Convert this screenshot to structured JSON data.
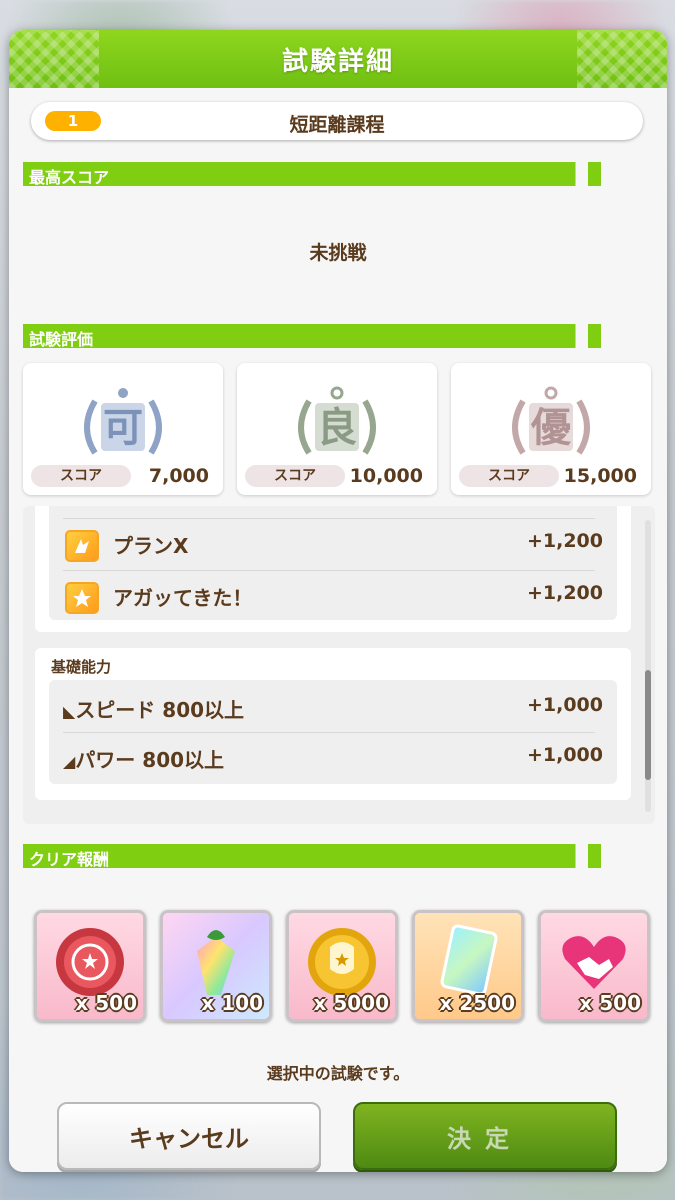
{
  "header": {
    "title": "試験詳細"
  },
  "exam": {
    "number": "1",
    "name": "短距離課程"
  },
  "best_score": {
    "section_title": "最高スコア",
    "value": "未挑戦"
  },
  "evaluation": {
    "section_title": "試験評価",
    "grades": [
      {
        "grade": "可",
        "score_label": "スコア",
        "score": "7,000"
      },
      {
        "grade": "良",
        "score_label": "スコア",
        "score": "10,000"
      },
      {
        "grade": "優",
        "score_label": "スコア",
        "score": "15,000"
      }
    ]
  },
  "skills": {
    "items": [
      {
        "label": "プランX",
        "value": "+1,200"
      },
      {
        "label": "アガッてきた！",
        "value": "+1,200"
      }
    ]
  },
  "abilities": {
    "title": "基礎能力",
    "items": [
      {
        "label": "スピード 800以上",
        "value": "+1,000"
      },
      {
        "label": "パワー 800以上",
        "value": "+1,000"
      }
    ]
  },
  "rewards": {
    "section_title": "クリア報酬",
    "items": [
      {
        "icon": "badge-icon",
        "qty": "x 500"
      },
      {
        "icon": "crystal-carrot-icon",
        "qty": "x 100"
      },
      {
        "icon": "gold-coin-icon",
        "qty": "x 5000"
      },
      {
        "icon": "rainbow-card-icon",
        "qty": "x 2500"
      },
      {
        "icon": "handshake-icon",
        "qty": "x 500"
      }
    ]
  },
  "status_text": "選択中の試験です。",
  "buttons": {
    "cancel": "キャンセル",
    "confirm": "決定"
  },
  "colors": {
    "accent": "#7fce12",
    "text": "#5a3b1e",
    "badge": "#ffb100"
  }
}
